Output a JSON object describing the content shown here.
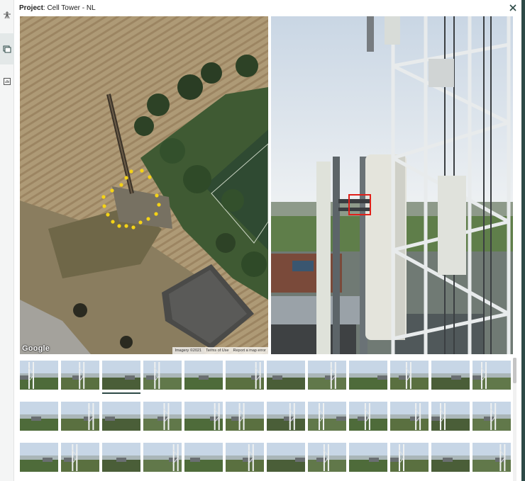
{
  "header": {
    "project_label": "Project",
    "project_name": ": Cell Tower - NL"
  },
  "icons": {
    "rail": [
      "tower-icon",
      "images-icon",
      "report-icon"
    ],
    "close": "close-icon"
  },
  "map": {
    "logo": "Google",
    "attribution": [
      "Imagery ©2021",
      "Terms of Use",
      "Report a map error"
    ]
  },
  "photo": {
    "highlight_color": "#e0201a"
  },
  "thumbnails": {
    "rows": 3,
    "per_row": 12,
    "selected_index": 2
  },
  "colors": {
    "accent": "#2e4a47",
    "marker": "#f5d316"
  }
}
